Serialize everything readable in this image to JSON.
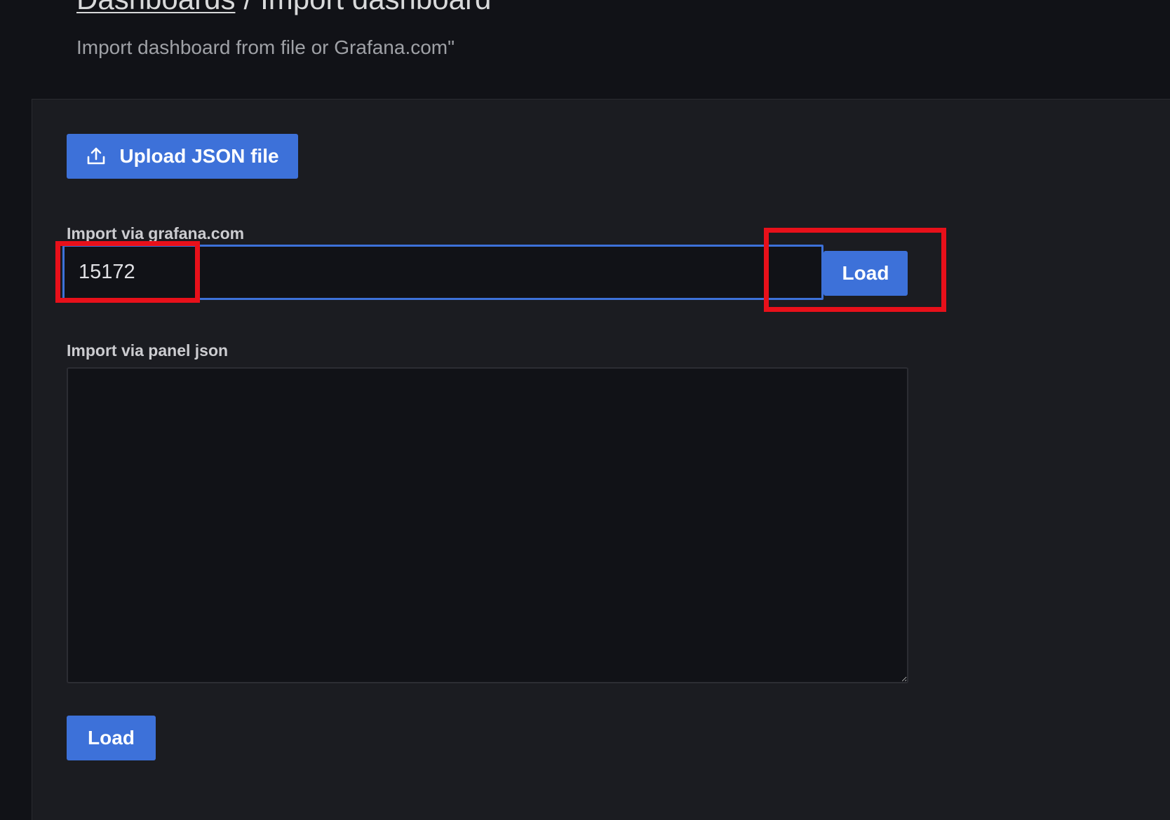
{
  "header": {
    "breadcrumb_link": "Dashboards",
    "breadcrumb_separator": "/",
    "breadcrumb_current": "Import dashboard",
    "subtitle": "Import dashboard from file or Grafana.com\""
  },
  "upload": {
    "label": "Upload JSON file",
    "icon": "upload-icon"
  },
  "grafana_com": {
    "label": "Import via grafana.com",
    "value": "15172",
    "load_label": "Load"
  },
  "panel_json": {
    "label": "Import via panel json",
    "value": "",
    "load_label": "Load"
  },
  "colors": {
    "primary": "#3d71d9",
    "highlight": "#e8101a",
    "background": "#111217",
    "panel": "#1b1c21"
  }
}
